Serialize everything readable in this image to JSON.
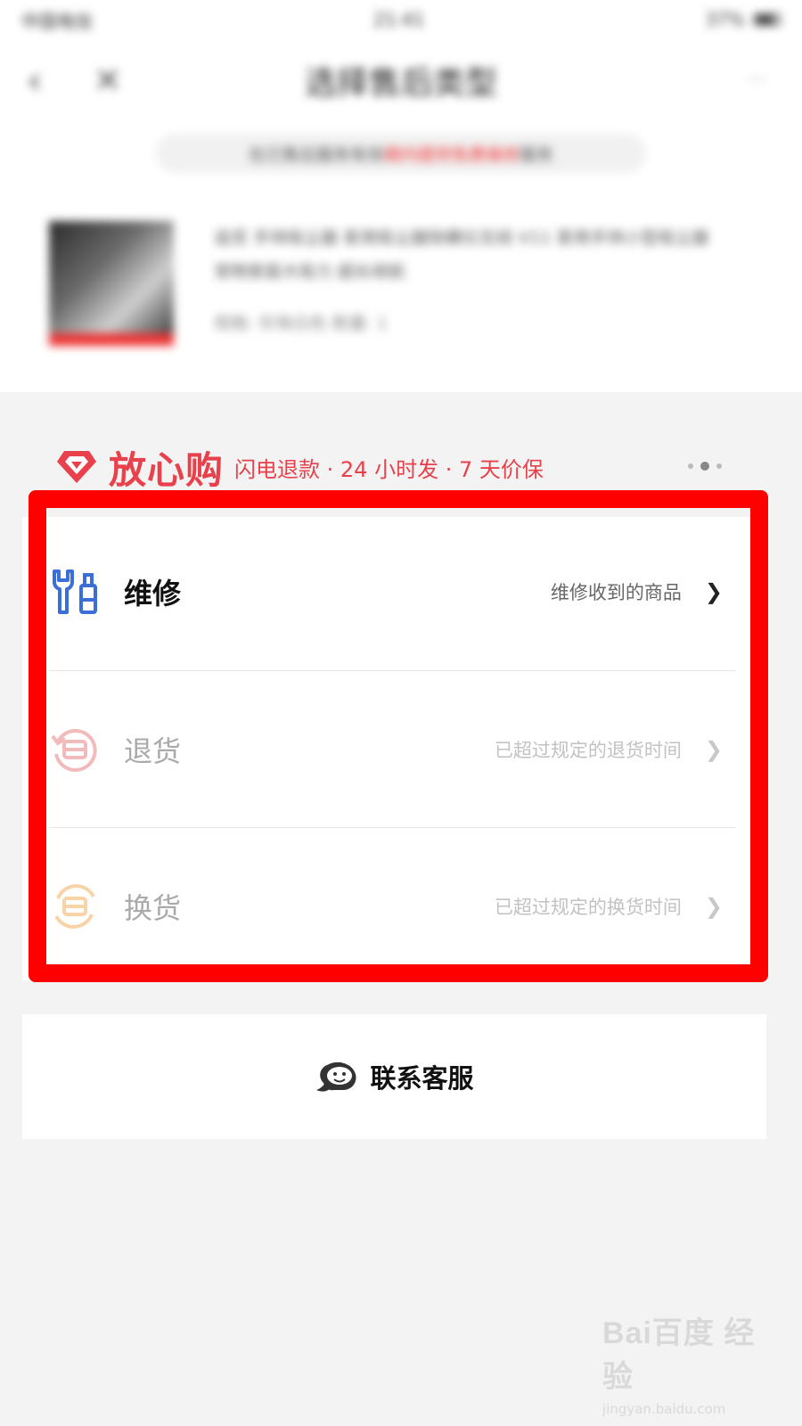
{
  "status_bar": {
    "carrier": "中国电信",
    "time": "21:41",
    "battery": "37%"
  },
  "nav": {
    "back_icon": "chevron-left-icon",
    "close_icon": "close-icon",
    "title": "选择售后类型",
    "more": "···"
  },
  "notice": {
    "text_before": "在已售后服务有效",
    "text_highlight": "期内提供免费维修",
    "text_after": "服务"
  },
  "product": {
    "info": "追觅 手持吸尘器 家用吸尘器除螨仪无线 V11 家用手持小型吸尘器 宠物家庭大吸力 超长续航",
    "spec": "规格: 珍珠白色 数量: 1"
  },
  "assurance": {
    "title": "放心购",
    "subtitle": "闪电退款 · 24 小时发 · 7 天价保",
    "color": "#e8414b"
  },
  "options": [
    {
      "label": "维修",
      "description": "维修收到的商品",
      "arrow": "❯",
      "icon": "wrench-icon",
      "enabled": true,
      "icon_color": "#3a6fd8"
    },
    {
      "label": "退货",
      "description": "已超过规定的退货时间",
      "arrow": "❯",
      "icon": "return-box-icon",
      "enabled": false,
      "icon_color": "#e36a6a"
    },
    {
      "label": "换货",
      "description": "已超过规定的换货时间",
      "arrow": "❯",
      "icon": "exchange-box-icon",
      "enabled": false,
      "icon_color": "#f0a040"
    }
  ],
  "contact": {
    "label": "联系客服",
    "icon": "chat-bubble-icon"
  },
  "highlight_color": "#ff0000",
  "watermark": {
    "logo": "Bai百度 经验",
    "url": "jingyan.baidu.com"
  }
}
